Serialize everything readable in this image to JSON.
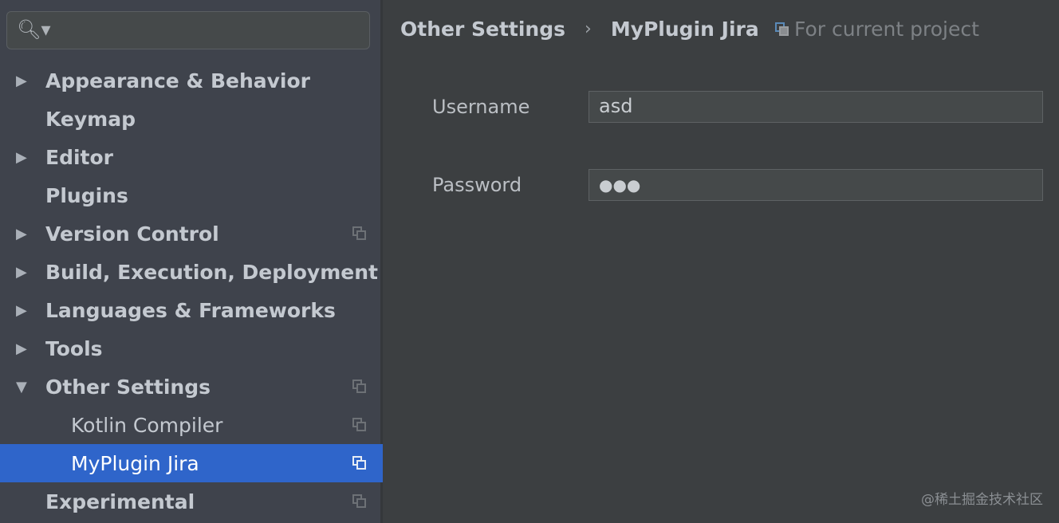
{
  "sidebar": {
    "search_icon": "search-icon",
    "items": [
      {
        "label": "Appearance & Behavior",
        "arrow": "▶",
        "project": false
      },
      {
        "label": "Keymap",
        "arrow": "",
        "project": false
      },
      {
        "label": "Editor",
        "arrow": "▶",
        "project": false
      },
      {
        "label": "Plugins",
        "arrow": "",
        "project": false
      },
      {
        "label": "Version Control",
        "arrow": "▶",
        "project": true
      },
      {
        "label": "Build, Execution, Deployment",
        "arrow": "▶",
        "project": false
      },
      {
        "label": "Languages & Frameworks",
        "arrow": "▶",
        "project": false
      },
      {
        "label": "Tools",
        "arrow": "▶",
        "project": false
      },
      {
        "label": "Other Settings",
        "arrow": "▼",
        "project": true
      },
      {
        "label": "Kotlin Compiler",
        "arrow": "",
        "project": true,
        "child": true
      },
      {
        "label": "MyPlugin Jira",
        "arrow": "",
        "project": true,
        "child": true,
        "selected": true
      },
      {
        "label": "Experimental",
        "arrow": "",
        "project": true
      }
    ]
  },
  "breadcrumb": {
    "parent": "Other Settings",
    "separator": "›",
    "current": "MyPlugin Jira"
  },
  "scope": "For current project",
  "form": {
    "username_label": "Username",
    "username_value": "asd",
    "password_label": "Password",
    "password_value": "●●●"
  },
  "watermark": "@稀土掘金技术社区"
}
